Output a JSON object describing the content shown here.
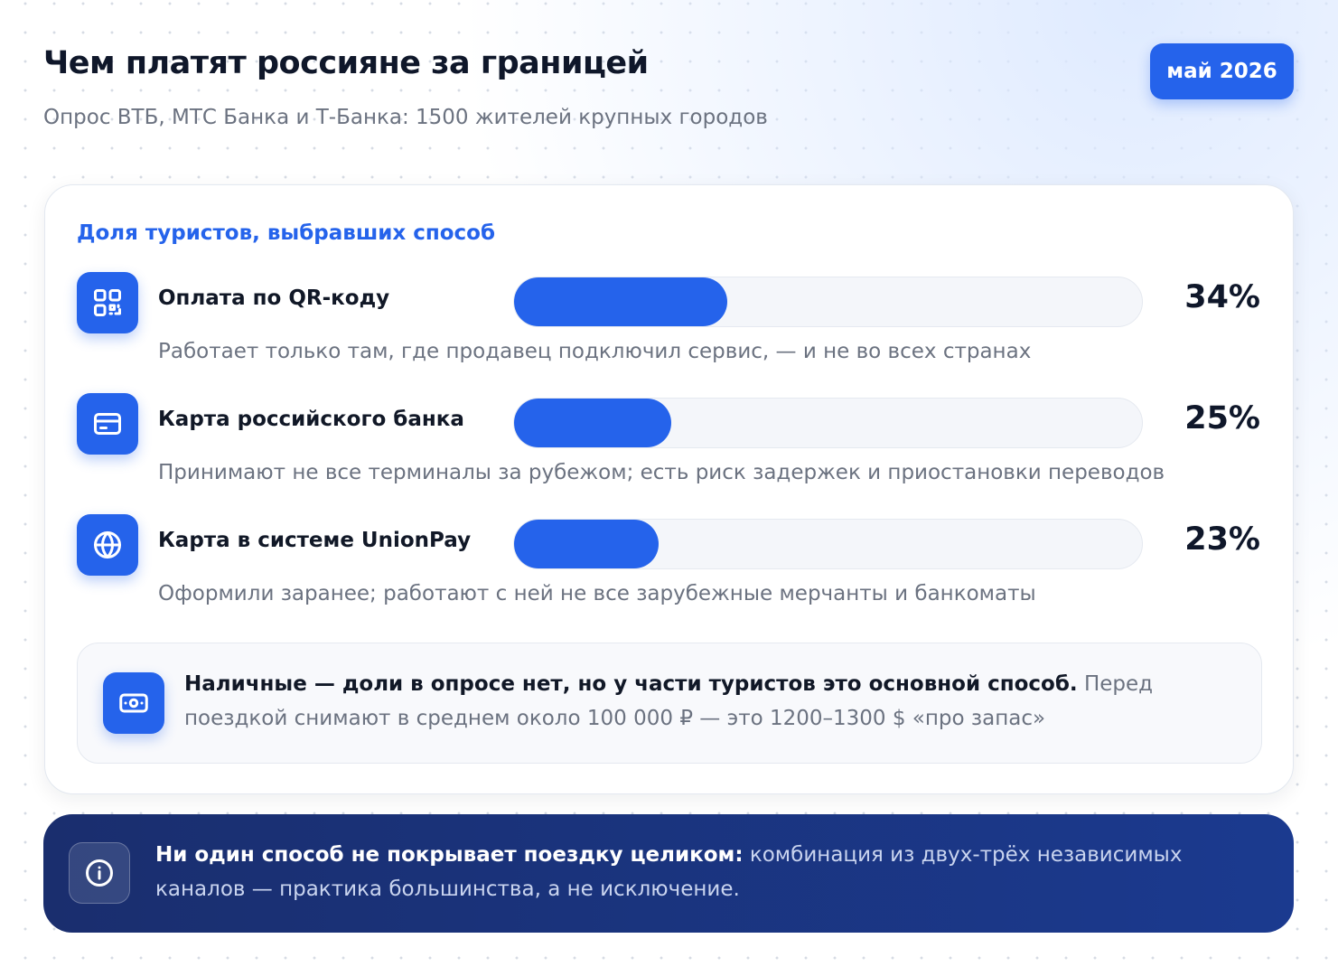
{
  "header": {
    "title": "Чем платят россияне за границей",
    "subtitle": "Опрос ВТБ, МТС Банка и Т-Банка: 1500 жителей крупных городов",
    "badge": "май 2026"
  },
  "chart_data": {
    "type": "bar",
    "title": "Доля туристов, выбравших способ",
    "categories": [
      "Оплата по QR-коду",
      "Карта российского банка",
      "Карта в системе UnionPay"
    ],
    "values": [
      34,
      25,
      23
    ],
    "value_labels": [
      "34%",
      "25%",
      "23%"
    ],
    "descriptions": [
      "Работает только там, где продавец подключил сервис, — и не во всех странах",
      "Принимают не все терминалы за рубежом; есть риск задержек и приостановки переводов",
      "Оформили заранее; работают с ней не все зарубежные мерчанты и банкоматы"
    ],
    "icons": [
      "qr-code-icon",
      "credit-card-icon",
      "globe-icon"
    ],
    "xlim": [
      0,
      100
    ],
    "bar_color": "#2563eb",
    "track_color": "#f4f6fa"
  },
  "cash_note": {
    "bold": "Наличные — доли в опросе нет, но у части туристов это основной способ.",
    "text": " Перед поездкой снимают в среднем около 100 000 ₽ — это 1200–1300 $ «про запас»",
    "icon": "banknote-icon"
  },
  "banner": {
    "bold": "Ни один способ не покрывает поездку целиком:",
    "text": " комбинация из двух-трёх независимых каналов — практика большинства, а не исключение.",
    "icon": "info-icon"
  },
  "colors": {
    "accent": "#2563eb",
    "banner_start": "#1a2e6e",
    "banner_end": "#1b3a8f"
  }
}
